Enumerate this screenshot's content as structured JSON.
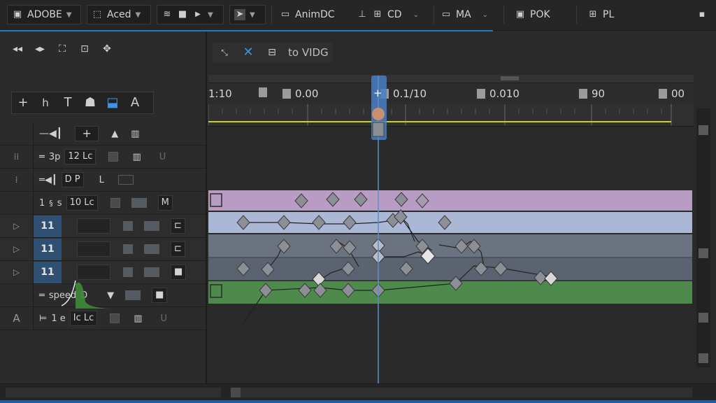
{
  "toolbar": {
    "group1": {
      "icon": "adobe-logo-icon",
      "label": "ADOBE"
    },
    "group2": {
      "icon": "frame-icon",
      "label": "Aced"
    },
    "group3": {
      "icon": "wifi-icon"
    },
    "group4": {
      "icon": "cursor-icon"
    },
    "group5": {
      "icon": "window-icon",
      "label": "AnimDC"
    },
    "group6": {
      "label": "CD"
    },
    "group7": {
      "label": "MA"
    },
    "group8": {
      "label": "POK"
    },
    "group9": {
      "label": "PL"
    }
  },
  "timeline_header": {
    "label": "to VIDG"
  },
  "ruler": {
    "labels": [
      "1:10",
      "0.00",
      "0.1/10",
      "0.010",
      "90",
      "00"
    ]
  },
  "layers": {
    "row1": {
      "speed": "3p",
      "value": "12 Lc"
    },
    "row2": {
      "value": "D P"
    },
    "row3": {
      "num": "1",
      "unit": "s",
      "value": "10 Lc"
    },
    "row4": {
      "num": "11"
    },
    "row5": {
      "num": "11"
    },
    "row6": {
      "num": "11"
    },
    "row7": {
      "label": "speed",
      "value": "D"
    },
    "row8": {
      "label": "1 e",
      "value": "Ic Lc"
    }
  },
  "colors": {
    "accent": "#2a74c4",
    "playhead": "#5a8fd0",
    "lavender_track": "#b89cc4",
    "blue_track": "#aab8d6",
    "gray_track": "#6c7380",
    "green_track": "#4e8a4c",
    "yellow_line": "#c8d02a"
  }
}
